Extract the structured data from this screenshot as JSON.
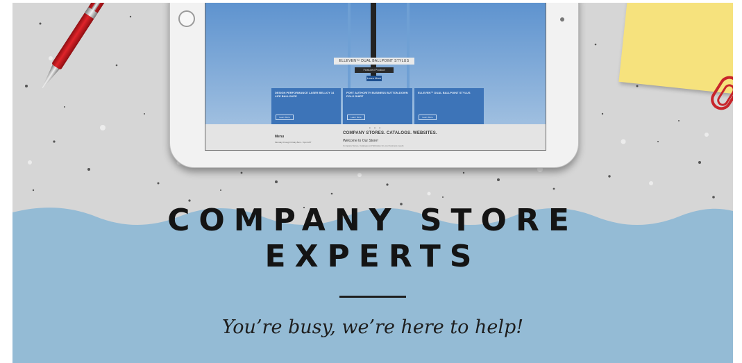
{
  "banner": {
    "headline_line1": "COMPANY STORE",
    "headline_line2": "EXPERTS",
    "tagline": "You’re busy, we’re here to help!",
    "colors": {
      "wave_blue": "#94bbd5",
      "concrete": "#d6d6d6",
      "headline": "#141414",
      "sticky_note": "#f6e27d",
      "pen_red": "#e0242a"
    },
    "icons": [
      "red-pen-icon",
      "sticky-note-icon",
      "paper-clip-icon",
      "tablet-device-icon"
    ]
  },
  "tablet_screen": {
    "hero_tag": "ELLEVEN™ DUAL BALLPOINT STYLUS",
    "hero_sub": "Featured Product",
    "hero_button": "Learn More",
    "promos": [
      {
        "title": "DESIGN PERFORMANCE LASER BELLOY 14 LIFE BALLOUPE",
        "button": "Learn More"
      },
      {
        "title": "PORT AUTHORITY BUSINESS BUTTON-DOWN POLO SHIRT",
        "button": "Learn More"
      },
      {
        "title": "ELLEVEN™ DUAL BALLPOINT STYLUS",
        "button": "Learn More"
      }
    ],
    "dots": "• • •",
    "menu_label": "Menu",
    "menu_sub": "Monday through Friday 8am - 5pm EST",
    "stores_title": "COMPANY STORES. CATALOGS. WEBSITES.",
    "welcome": "Welcome to Our Store!",
    "welcome_sub": "Company Stores, Catalogs and Websites for your business needs"
  }
}
